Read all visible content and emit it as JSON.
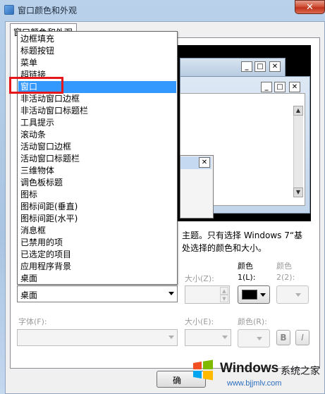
{
  "window": {
    "title": "窗口颜色和外观",
    "close_glyph": "✕"
  },
  "tab": {
    "label": "窗口颜色和外观"
  },
  "preview": {
    "button_min": "_",
    "button_max": "□",
    "button_close": "✕",
    "scroll_up": "▲",
    "scroll_down": "▼"
  },
  "description": {
    "line1": "主题。只有选择 Windows 7“基",
    "line2": "处选择的颜色和大小。"
  },
  "item_row": {
    "size_label": "大小(Z):",
    "color1_label_a": "颜色",
    "color1_label_b": "1(L):",
    "color2_label_a": "颜色",
    "color2_label_b": "2(2):",
    "item_selected": "桌面",
    "color1_value": "#000000"
  },
  "font_row": {
    "font_label": "字体(F):",
    "size_label": "大小(E):",
    "color_label": "颜色(R):",
    "bold_label": "B",
    "italic_label": "I"
  },
  "dropdown": {
    "items": [
      "边框填充",
      "标题按钮",
      "菜单",
      "超链接",
      "窗口",
      "非活动窗口边框",
      "非活动窗口标题栏",
      "工具提示",
      "滚动条",
      "活动窗口边框",
      "活动窗口标题栏",
      "三维物体",
      "调色板标题",
      "图标",
      "图标间距(垂直)",
      "图标间距(水平)",
      "消息框",
      "已禁用的项",
      "已选定的项目",
      "应用程序背景",
      "桌面"
    ],
    "selected_index": 4
  },
  "ok_button": {
    "label": "确"
  },
  "watermark": {
    "brand": "Windows",
    "suffix": "系统之家",
    "url": "www.bjjmlv.com"
  }
}
